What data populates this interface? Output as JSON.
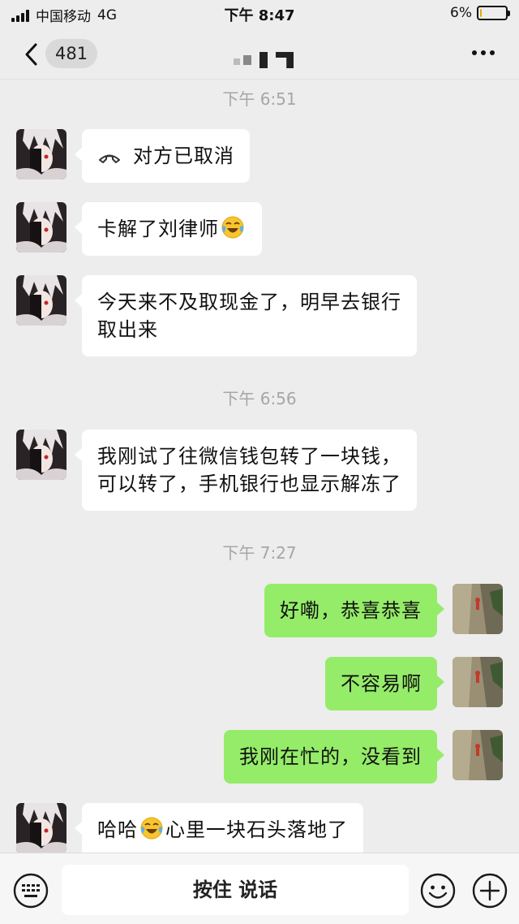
{
  "status_bar": {
    "carrier": "中国移动",
    "network": "4G",
    "time": "下午 8:47",
    "battery": "6%",
    "battery_level": 0.06
  },
  "nav": {
    "unread_count": "481"
  },
  "colors": {
    "background": "#ededed",
    "bubble_self": "#95ec69",
    "bubble_other": "#ffffff",
    "timestamp": "#a6a6a6"
  },
  "messages": [
    {
      "type": "timestamp",
      "text": "下午 6:51"
    },
    {
      "type": "call",
      "from": "other",
      "text": "对方已取消",
      "icon": "phone-hangup-icon"
    },
    {
      "type": "text",
      "from": "other",
      "text": "卡解了刘律师",
      "emoji_after": "tears-of-joy-emoji"
    },
    {
      "type": "text",
      "from": "other",
      "line1": "今天来不及取现金了，明早去银行",
      "line2": "取出来"
    },
    {
      "type": "timestamp",
      "text": "下午 6:56"
    },
    {
      "type": "text",
      "from": "other",
      "line1": "我刚试了往微信钱包转了一块钱，",
      "line2": "可以转了，手机银行也显示解冻了"
    },
    {
      "type": "timestamp",
      "text": "下午 7:27"
    },
    {
      "type": "text",
      "from": "self",
      "text": "好嘞，恭喜恭喜"
    },
    {
      "type": "text",
      "from": "self",
      "text": "不容易啊"
    },
    {
      "type": "text",
      "from": "self",
      "text": "我刚在忙的，没看到"
    },
    {
      "type": "text",
      "from": "other",
      "text_before": "哈哈",
      "emoji_mid": "tears-of-joy-emoji",
      "text_after": "心里一块石头落地了"
    }
  ],
  "input_bar": {
    "hold_to_talk": "按住 说话",
    "left_icon": "keyboard-icon",
    "right_icons": [
      "emoji-icon",
      "plus-icon"
    ]
  }
}
